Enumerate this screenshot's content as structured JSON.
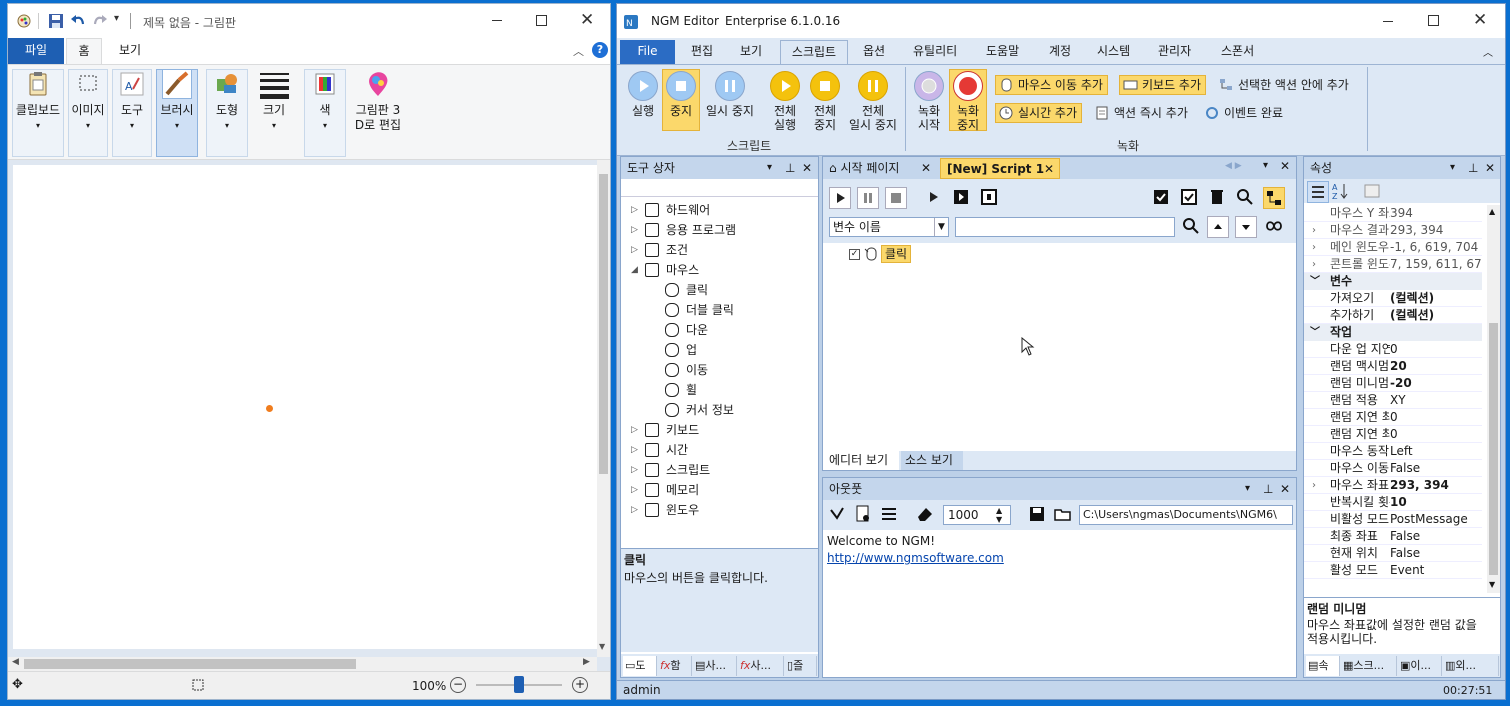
{
  "paint": {
    "title": "제목 없음 - 그림판",
    "menu": {
      "file": "파일",
      "home": "홈",
      "view": "보기"
    },
    "tools": [
      {
        "label": "클립보드",
        "icon": "clipboard-icon"
      },
      {
        "label": "이미지",
        "icon": "select-icon"
      },
      {
        "label": "도구",
        "icon": "tools-icon"
      },
      {
        "label": "브러시",
        "icon": "brush-icon"
      },
      {
        "label": "도형",
        "icon": "shapes-icon"
      },
      {
        "label": "크기",
        "icon": "size-icon"
      },
      {
        "label": "색",
        "icon": "colors-icon"
      },
      {
        "label": "그림판 3",
        "label2": "D로 편집",
        "icon": "paint3d-icon"
      }
    ],
    "zoom": "100%",
    "dot_color": "#f07d1e"
  },
  "ngm": {
    "title": "NGM Editor",
    "edition": "Enterprise 6.1.0.16",
    "menus": [
      "File",
      "편집",
      "보기",
      "스크립트",
      "옵션",
      "유틸리티",
      "도움말",
      "계정",
      "시스템",
      "관리자",
      "스폰서"
    ],
    "ribbon": {
      "run": "실행",
      "stop": "중지",
      "pause": "일시 중지",
      "all_run": [
        "전체",
        "실행"
      ],
      "all_stop": [
        "전체",
        "중지"
      ],
      "all_pause": [
        "전체",
        "일시 중지"
      ],
      "group_script": "스크립트",
      "rec_start": [
        "녹화",
        "시작"
      ],
      "rec_stop": [
        "녹화",
        "중지"
      ],
      "add_mouse": "마우스 이동 추가",
      "add_keyboard": "키보드 추가",
      "add_inside": "선택한 액션 안에 추가",
      "add_realtime": "실시간 추가",
      "add_instant": "액션 즉시 추가",
      "event_done": "이벤트 완료",
      "group_record": "녹화"
    },
    "toolbox": {
      "title": "도구 상자",
      "items": [
        {
          "label": "하드웨어",
          "expanded": false
        },
        {
          "label": "응용 프로그램",
          "expanded": false
        },
        {
          "label": "조건",
          "expanded": false
        },
        {
          "label": "마우스",
          "expanded": true
        },
        {
          "label": "클릭",
          "child": true
        },
        {
          "label": "더블 클릭",
          "child": true
        },
        {
          "label": "다운",
          "child": true
        },
        {
          "label": "업",
          "child": true
        },
        {
          "label": "이동",
          "child": true
        },
        {
          "label": "휠",
          "child": true
        },
        {
          "label": "커서 정보",
          "child": true
        },
        {
          "label": "키보드",
          "expanded": false
        },
        {
          "label": "시간",
          "expanded": false
        },
        {
          "label": "스크립트",
          "expanded": false
        },
        {
          "label": "메모리",
          "expanded": false
        },
        {
          "label": "윈도우",
          "expanded": false
        }
      ],
      "desc_title": "클릭",
      "desc_text": "마우스의 버튼을 클릭합니다.",
      "bottom_tabs": [
        "도",
        "함",
        "사...",
        "사...",
        "즐"
      ]
    },
    "doc_tabs": [
      "시작 페이지",
      "[New] Script 1"
    ],
    "var_select": "변수 이름",
    "script_node": "클릭",
    "editor_tabs": [
      "에디터 보기",
      "소스 보기"
    ],
    "output": {
      "title": "아웃풋",
      "value": "1000",
      "path": "C:\\Users\\ngmas\\Documents\\NGM6\\",
      "line1": "Welcome to NGM!",
      "line2": "http://www.ngmsoftware.com"
    },
    "props": {
      "title": "속성",
      "rows": [
        {
          "k": "마우스 Y 좌표",
          "v": "394",
          "dim": true
        },
        {
          "k": "마우스 결과",
          "v": "293, 394",
          "dim": true,
          "exp": true
        },
        {
          "k": "메인 윈도우",
          "v": "-1, 6, 619, 704",
          "dim": true,
          "exp": true
        },
        {
          "k": "콘트롤 윈도우",
          "v": "7, 159, 611, 670",
          "dim": true,
          "exp": true
        },
        {
          "cat": "변수"
        },
        {
          "k": "가져오기",
          "v": "(컬렉션)",
          "bold": true
        },
        {
          "k": "추가하기",
          "v": "(컬렉션)",
          "bold": true
        },
        {
          "cat": "작업"
        },
        {
          "k": "다운 업 지연",
          "v": "0"
        },
        {
          "k": "랜덤 맥시멈",
          "v": "20",
          "bold": true
        },
        {
          "k": "랜덤 미니멈",
          "v": "-20",
          "bold": true
        },
        {
          "k": "랜덤 적용",
          "v": "XY"
        },
        {
          "k": "랜덤 지연 최대",
          "v": "0"
        },
        {
          "k": "랜덤 지연 최소",
          "v": "0"
        },
        {
          "k": "마우스 동작",
          "v": "Left"
        },
        {
          "k": "마우스 이동",
          "v": "False"
        },
        {
          "k": "마우스 좌표",
          "v": "293, 394",
          "bold": true,
          "exp": true
        },
        {
          "k": "반복시킬 횟수",
          "v": "10",
          "bold": true
        },
        {
          "k": "비활성 모드",
          "v": "PostMessage"
        },
        {
          "k": "최종 좌표",
          "v": "False"
        },
        {
          "k": "현재 위치",
          "v": "False"
        },
        {
          "k": "활성 모드",
          "v": "Event"
        }
      ],
      "desc_title": "랜덤 미니멈",
      "desc_text1": "마우스 좌표값에 설정한 랜덤 값을",
      "desc_text2": "적용시킵니다.",
      "bottom_tabs": [
        "속",
        "스크...",
        "이...",
        "외..."
      ]
    },
    "status_user": "admin",
    "status_time": "00:27:51"
  }
}
